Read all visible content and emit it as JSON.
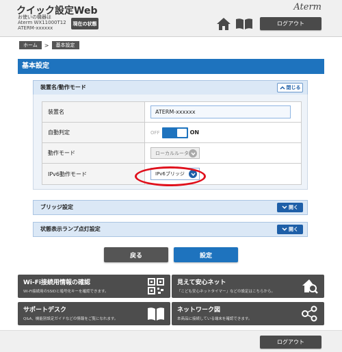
{
  "header": {
    "app_title": "クイック設定Web",
    "device_label": "お使いの機器は",
    "device_model": "Aterm WX11000T12",
    "device_name": "ATERM-xxxxxx",
    "status_button": "現在の状態",
    "brand": "Aterm",
    "logout": "ログアウト"
  },
  "breadcrumb": [
    "ホーム",
    ">",
    "基本設定"
  ],
  "page_title": "基本設定",
  "sections": {
    "device": {
      "title": "装置名/動作モード",
      "toggle": "閉じる"
    },
    "bridge": {
      "title": "ブリッジ設定",
      "toggle": "開く"
    },
    "lamp": {
      "title": "状態表示ランプ点灯設定",
      "toggle": "開く"
    }
  },
  "rows": {
    "device_name": {
      "label": "装置名",
      "value": "ATERM-xxxxxx"
    },
    "auto_detect": {
      "label": "自動判定",
      "off": "OFF",
      "on": "ON",
      "state": "on"
    },
    "mode": {
      "label": "動作モード",
      "value": "ローカルルータ"
    },
    "ipv6": {
      "label": "IPv6動作モード",
      "value": "IPv6ブリッジ"
    }
  },
  "buttons": {
    "back": "戻る",
    "apply": "設定"
  },
  "tiles": {
    "wifi": {
      "title": "Wi-Fi接続用情報の確認",
      "desc": "Wi-Fi接続用のSSIDと暗号化キーを確認できます。",
      "icon": "qr-code-icon"
    },
    "safe": {
      "title": "見えて安心ネット",
      "desc": "「こども安心ネットタイマー」などの設定はこちらから。",
      "icon": "house-search-icon"
    },
    "support": {
      "title": "サポートデスク",
      "desc": "Q&A、機能別設定ガイドなどの情報をご覧になれます。",
      "icon": "book-icon"
    },
    "network": {
      "title": "ネットワーク図",
      "desc": "本商品に接続している端末を確認できます。",
      "icon": "network-icon"
    }
  },
  "footer": {
    "logout": "ログアウト"
  },
  "colors": {
    "accent": "#1e73be",
    "dark": "#4d4d4d",
    "highlight": "#e0101c"
  }
}
